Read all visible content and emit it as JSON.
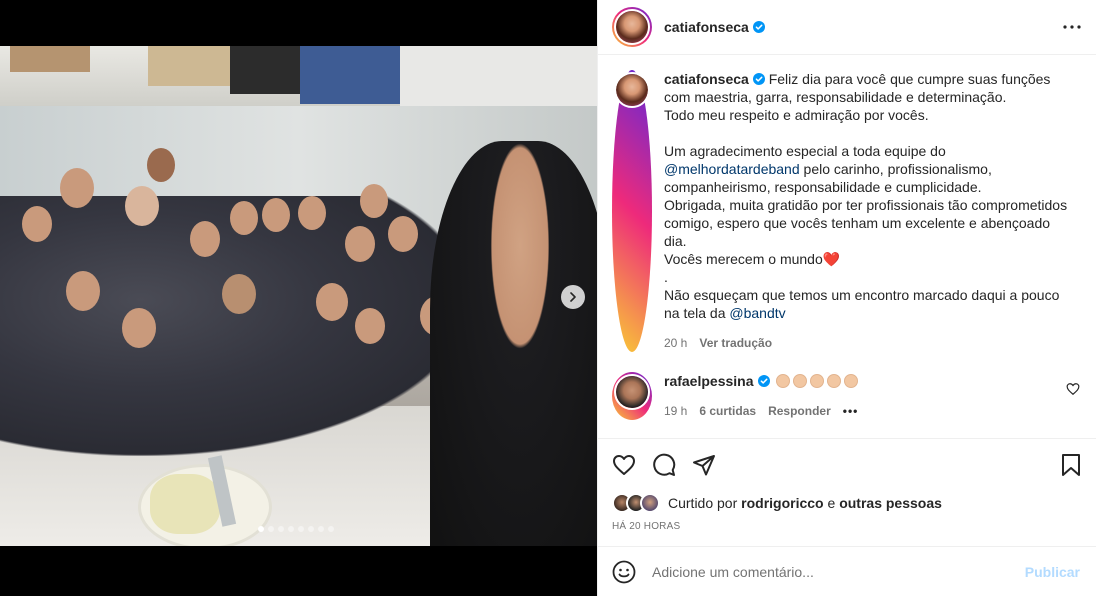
{
  "post": {
    "author": "catiafonseca",
    "carousel": {
      "slide_count": 8,
      "active_index": 0
    }
  },
  "caption": {
    "username": "catiafonseca",
    "text_1": "Feliz dia para você que cumpre suas funções com maestria, garra, responsabilidade e determinação.\nTodo meu respeito e admiração por vocês.\n\nUm agradecimento especial a toda equipe do ",
    "mention_1": "@melhordatardeband",
    "text_2": " pelo carinho, profissionalismo, companheirismo, responsabilidade e cumplicidade.\nObrigada, muita gratidão por ter profissionais tão comprometidos comigo, espero que vocês tenham um excelente e abençoado dia.\nVocês merecem o mundo❤️\n.\nNão esqueçam que temos um encontro marcado daqui a pouco na tela da ",
    "mention_2": "@bandtv",
    "time": "20 h",
    "translate": "Ver tradução"
  },
  "comment": {
    "username": "rafaelpessina",
    "time": "19 h",
    "likes": "6 curtidas",
    "reply": "Responder",
    "more": "•••"
  },
  "likes": {
    "prefix": "Curtido por ",
    "user": "rodrigoricco",
    "middle": " e ",
    "others": "outras pessoas"
  },
  "timestamp": "HÁ 20 HORAS",
  "add_comment": {
    "placeholder": "Adicione um comentário...",
    "publish": "Publicar"
  },
  "colors": {
    "verified": "#0095f6",
    "link": "#00376b",
    "publish_disabled": "#b3dbff",
    "heart": "#e0245e"
  }
}
